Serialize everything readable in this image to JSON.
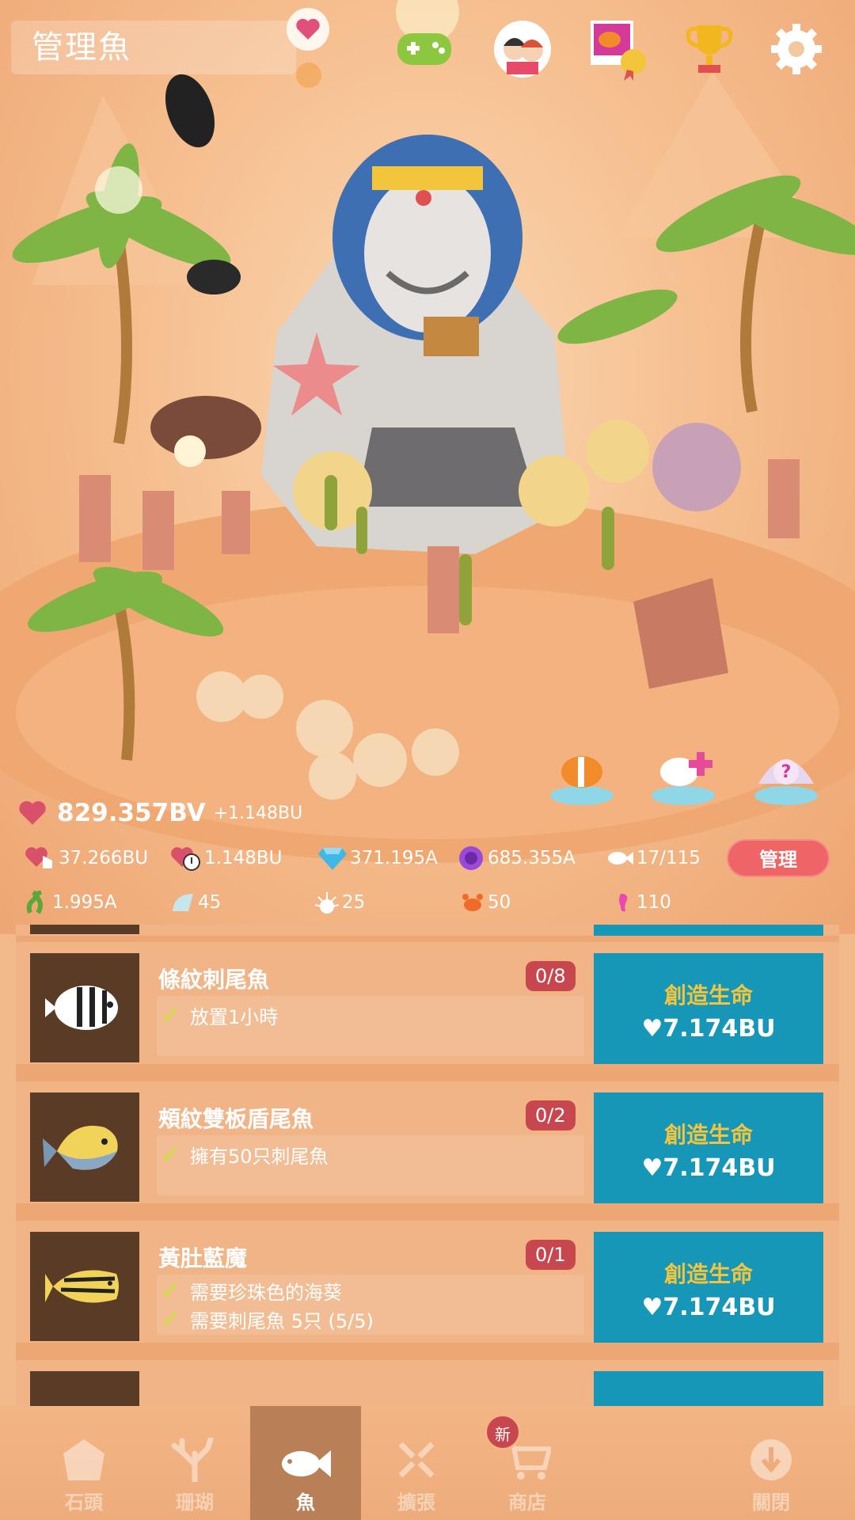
{
  "header": {
    "title": "管理魚",
    "icons": [
      "heart-bubble-icon",
      "gamepad-icon",
      "friends-icon",
      "achievement-icon",
      "trophy-icon",
      "gear-icon"
    ]
  },
  "stats": {
    "total_vitality": "829.357BV",
    "per_tap": "+1.148BU",
    "tap_value": "37.266BU",
    "timed_value": "1.148BU",
    "gems": "371.195A",
    "pearls": "685.355A",
    "fish_count": "17/115",
    "manage_label": "管理",
    "plants": "1.995A",
    "shells": "45",
    "urchins": "25",
    "crabs": "50",
    "seahorses": "110"
  },
  "colors": {
    "accent_blue": "#1797b8",
    "badge_red": "#c8474f",
    "gold_text": "#f4c43c",
    "check_green": "#c8e23a"
  },
  "fish_list": [
    {
      "name": "條紋刺尾魚",
      "count": "0/8",
      "requirements": [
        "放置1小時"
      ],
      "button_title": "創造生命",
      "button_cost": "7.174BU"
    },
    {
      "name": "頰紋雙板盾尾魚",
      "count": "0/2",
      "requirements": [
        "擁有50只刺尾魚"
      ],
      "button_title": "創造生命",
      "button_cost": "7.174BU"
    },
    {
      "name": "黃肚藍魔",
      "count": "0/1",
      "requirements": [
        "需要珍珠色的海葵",
        "需要刺尾魚 5只 (5/5)"
      ],
      "button_title": "創造生命",
      "button_cost": "7.174BU"
    }
  ],
  "nav": {
    "tabs": [
      "石頭",
      "珊瑚",
      "魚",
      "擴張",
      "商店",
      "關閉"
    ],
    "new_badge": "新"
  }
}
